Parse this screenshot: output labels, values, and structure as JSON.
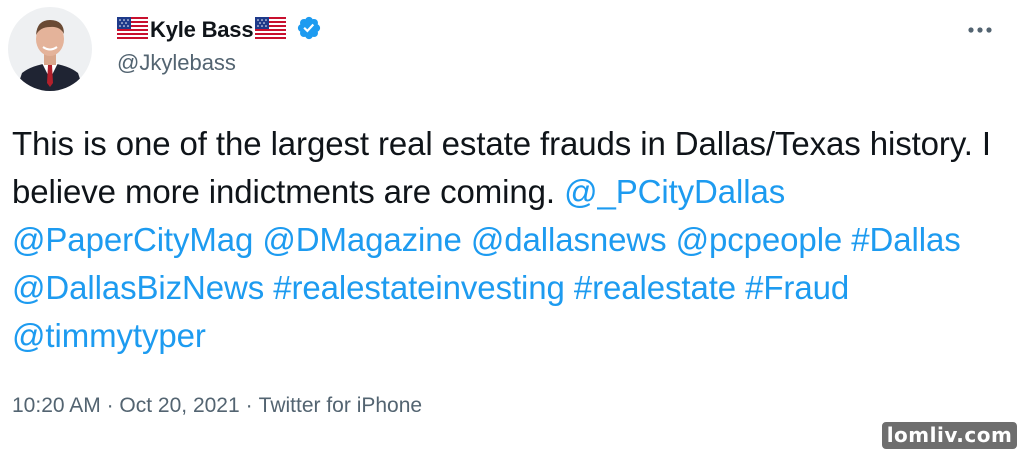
{
  "author": {
    "display_name": "Kyle Bass",
    "handle": "@Jkylebass",
    "verified": true,
    "flag_icon": "us-flag-icon"
  },
  "tweet": {
    "text_parts": [
      {
        "type": "text",
        "value": "This is one of the largest real estate frauds in Dallas/Texas history. I believe more indictments are coming. "
      },
      {
        "type": "mention",
        "value": "@_PCityDallas"
      },
      {
        "type": "text",
        "value": " "
      },
      {
        "type": "mention",
        "value": "@PaperCityMag"
      },
      {
        "type": "text",
        "value": " "
      },
      {
        "type": "mention",
        "value": "@DMagazine"
      },
      {
        "type": "text",
        "value": " "
      },
      {
        "type": "mention",
        "value": "@dallasnews"
      },
      {
        "type": "text",
        "value": " "
      },
      {
        "type": "mention",
        "value": "@pcpeople"
      },
      {
        "type": "text",
        "value": " "
      },
      {
        "type": "hashtag",
        "value": "#Dallas"
      },
      {
        "type": "text",
        "value": " "
      },
      {
        "type": "mention",
        "value": "@DallasBizNews"
      },
      {
        "type": "text",
        "value": " "
      },
      {
        "type": "hashtag",
        "value": "#realestateinvesting"
      },
      {
        "type": "text",
        "value": " "
      },
      {
        "type": "hashtag",
        "value": "#realestate"
      },
      {
        "type": "text",
        "value": " "
      },
      {
        "type": "hashtag",
        "value": "#Fraud"
      },
      {
        "type": "text",
        "value": " "
      },
      {
        "type": "mention",
        "value": "@timmytyper"
      }
    ]
  },
  "meta": {
    "time": "10:20 AM",
    "separator": "·",
    "date": "Oct 20, 2021",
    "source": "Twitter for iPhone"
  },
  "watermark": {
    "text": "lomliv.com"
  },
  "colors": {
    "link": "#1d9bf0",
    "secondary_text": "#536471",
    "primary_text": "#0f1419",
    "verified_badge": "#1d9bf0"
  }
}
